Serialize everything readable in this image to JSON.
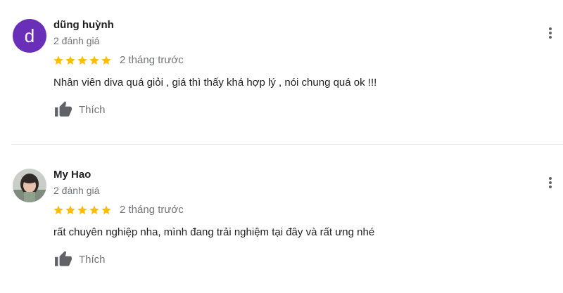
{
  "reviews": [
    {
      "avatar_letter": "d",
      "avatar_color": "#6a2fb8",
      "name": "dũng huỳnh",
      "review_count": "2 đánh giá",
      "rating": 5,
      "date": "2 tháng trước",
      "text": "Nhân viên diva quá giỏi , giá thì thấy khá hợp lý , nói chung quá ok !!!",
      "like_label": "Thích"
    },
    {
      "avatar_letter": "",
      "name": "My Hao",
      "review_count": "2 đánh giá",
      "rating": 5,
      "date": "2 tháng trước",
      "text": "rất chuyên nghiệp nha, mình đang trải nghiệm tại đây và rất ưng nhé",
      "like_label": "Thích"
    }
  ],
  "colors": {
    "star": "#fbbc04",
    "secondary_text": "#70757a",
    "icon": "#5f6368"
  },
  "icons": [
    "star-icon",
    "thumb-up-icon",
    "more-vert-icon"
  ]
}
